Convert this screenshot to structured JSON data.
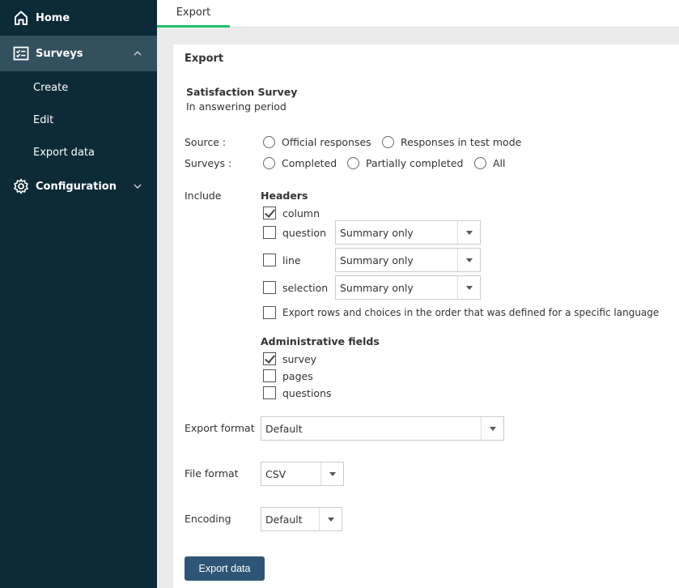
{
  "sidebar": {
    "home": {
      "label": "Home",
      "icon": "home-icon"
    },
    "surveys": {
      "label": "Surveys",
      "icon": "survey-icon"
    },
    "submenu": [
      {
        "label": "Create"
      },
      {
        "label": "Edit"
      },
      {
        "label": "Export data"
      }
    ],
    "configuration": {
      "label": "Configuration",
      "icon": "gear-icon"
    }
  },
  "tabs": [
    {
      "label": "Export"
    }
  ],
  "panel": {
    "title": "Export",
    "survey_name": "Satisfaction Survey",
    "survey_status": "In answering period",
    "source": {
      "label": "Source :",
      "options": [
        {
          "label": "Official responses"
        },
        {
          "label": "Responses in test mode"
        }
      ]
    },
    "surveys": {
      "label": "Surveys :",
      "options": [
        {
          "label": "Completed"
        },
        {
          "label": "Partially completed"
        },
        {
          "label": "All"
        }
      ]
    },
    "include_label": "Include",
    "headers": {
      "title": "Headers",
      "column": {
        "label": "column",
        "checked": true
      },
      "question": {
        "label": "question",
        "checked": false,
        "select": "Summary only"
      },
      "line": {
        "label": "line",
        "checked": false,
        "select": "Summary only"
      },
      "selection": {
        "label": "selection",
        "checked": false,
        "select": "Summary only"
      },
      "order": {
        "label": "Export rows and choices in the order that was defined for a specific language",
        "checked": false
      }
    },
    "admin": {
      "title": "Administrative fields",
      "items": [
        {
          "label": "survey",
          "checked": true
        },
        {
          "label": "pages",
          "checked": false
        },
        {
          "label": "questions",
          "checked": false
        }
      ]
    },
    "export_format": {
      "label": "Export format",
      "value": "Default"
    },
    "file_format": {
      "label": "File format",
      "value": "CSV"
    },
    "encoding": {
      "label": "Encoding",
      "value": "Default"
    },
    "submit_label": "Export data"
  },
  "colors": {
    "sidebar_bg": "#0d2a38",
    "sidebar_active": "#33505f",
    "tab_accent": "#1fc36a",
    "button": "#2e5575"
  }
}
